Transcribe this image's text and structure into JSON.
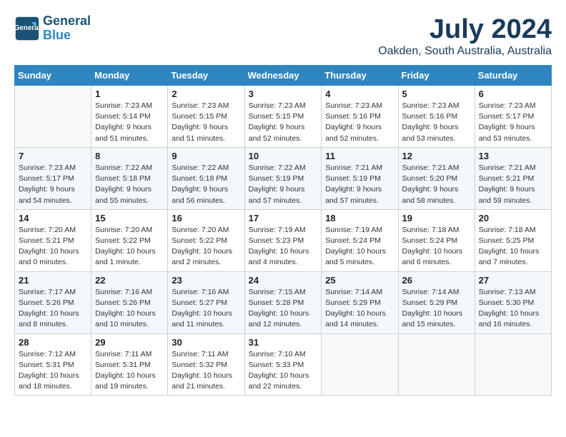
{
  "logo": {
    "line1": "General",
    "line2": "Blue"
  },
  "title": "July 2024",
  "location": "Oakden, South Australia, Australia",
  "days_of_week": [
    "Sunday",
    "Monday",
    "Tuesday",
    "Wednesday",
    "Thursday",
    "Friday",
    "Saturday"
  ],
  "weeks": [
    [
      {
        "day": "",
        "info": ""
      },
      {
        "day": "1",
        "info": "Sunrise: 7:23 AM\nSunset: 5:14 PM\nDaylight: 9 hours\nand 51 minutes."
      },
      {
        "day": "2",
        "info": "Sunrise: 7:23 AM\nSunset: 5:15 PM\nDaylight: 9 hours\nand 51 minutes."
      },
      {
        "day": "3",
        "info": "Sunrise: 7:23 AM\nSunset: 5:15 PM\nDaylight: 9 hours\nand 52 minutes."
      },
      {
        "day": "4",
        "info": "Sunrise: 7:23 AM\nSunset: 5:16 PM\nDaylight: 9 hours\nand 52 minutes."
      },
      {
        "day": "5",
        "info": "Sunrise: 7:23 AM\nSunset: 5:16 PM\nDaylight: 9 hours\nand 53 minutes."
      },
      {
        "day": "6",
        "info": "Sunrise: 7:23 AM\nSunset: 5:17 PM\nDaylight: 9 hours\nand 53 minutes."
      }
    ],
    [
      {
        "day": "7",
        "info": "Sunrise: 7:23 AM\nSunset: 5:17 PM\nDaylight: 9 hours\nand 54 minutes."
      },
      {
        "day": "8",
        "info": "Sunrise: 7:22 AM\nSunset: 5:18 PM\nDaylight: 9 hours\nand 55 minutes."
      },
      {
        "day": "9",
        "info": "Sunrise: 7:22 AM\nSunset: 5:18 PM\nDaylight: 9 hours\nand 56 minutes."
      },
      {
        "day": "10",
        "info": "Sunrise: 7:22 AM\nSunset: 5:19 PM\nDaylight: 9 hours\nand 57 minutes."
      },
      {
        "day": "11",
        "info": "Sunrise: 7:21 AM\nSunset: 5:19 PM\nDaylight: 9 hours\nand 57 minutes."
      },
      {
        "day": "12",
        "info": "Sunrise: 7:21 AM\nSunset: 5:20 PM\nDaylight: 9 hours\nand 58 minutes."
      },
      {
        "day": "13",
        "info": "Sunrise: 7:21 AM\nSunset: 5:21 PM\nDaylight: 9 hours\nand 59 minutes."
      }
    ],
    [
      {
        "day": "14",
        "info": "Sunrise: 7:20 AM\nSunset: 5:21 PM\nDaylight: 10 hours\nand 0 minutes."
      },
      {
        "day": "15",
        "info": "Sunrise: 7:20 AM\nSunset: 5:22 PM\nDaylight: 10 hours\nand 1 minute."
      },
      {
        "day": "16",
        "info": "Sunrise: 7:20 AM\nSunset: 5:22 PM\nDaylight: 10 hours\nand 2 minutes."
      },
      {
        "day": "17",
        "info": "Sunrise: 7:19 AM\nSunset: 5:23 PM\nDaylight: 10 hours\nand 4 minutes."
      },
      {
        "day": "18",
        "info": "Sunrise: 7:19 AM\nSunset: 5:24 PM\nDaylight: 10 hours\nand 5 minutes."
      },
      {
        "day": "19",
        "info": "Sunrise: 7:18 AM\nSunset: 5:24 PM\nDaylight: 10 hours\nand 6 minutes."
      },
      {
        "day": "20",
        "info": "Sunrise: 7:18 AM\nSunset: 5:25 PM\nDaylight: 10 hours\nand 7 minutes."
      }
    ],
    [
      {
        "day": "21",
        "info": "Sunrise: 7:17 AM\nSunset: 5:26 PM\nDaylight: 10 hours\nand 8 minutes."
      },
      {
        "day": "22",
        "info": "Sunrise: 7:16 AM\nSunset: 5:26 PM\nDaylight: 10 hours\nand 10 minutes."
      },
      {
        "day": "23",
        "info": "Sunrise: 7:16 AM\nSunset: 5:27 PM\nDaylight: 10 hours\nand 11 minutes."
      },
      {
        "day": "24",
        "info": "Sunrise: 7:15 AM\nSunset: 5:28 PM\nDaylight: 10 hours\nand 12 minutes."
      },
      {
        "day": "25",
        "info": "Sunrise: 7:14 AM\nSunset: 5:29 PM\nDaylight: 10 hours\nand 14 minutes."
      },
      {
        "day": "26",
        "info": "Sunrise: 7:14 AM\nSunset: 5:29 PM\nDaylight: 10 hours\nand 15 minutes."
      },
      {
        "day": "27",
        "info": "Sunrise: 7:13 AM\nSunset: 5:30 PM\nDaylight: 10 hours\nand 16 minutes."
      }
    ],
    [
      {
        "day": "28",
        "info": "Sunrise: 7:12 AM\nSunset: 5:31 PM\nDaylight: 10 hours\nand 18 minutes."
      },
      {
        "day": "29",
        "info": "Sunrise: 7:11 AM\nSunset: 5:31 PM\nDaylight: 10 hours\nand 19 minutes."
      },
      {
        "day": "30",
        "info": "Sunrise: 7:11 AM\nSunset: 5:32 PM\nDaylight: 10 hours\nand 21 minutes."
      },
      {
        "day": "31",
        "info": "Sunrise: 7:10 AM\nSunset: 5:33 PM\nDaylight: 10 hours\nand 22 minutes."
      },
      {
        "day": "",
        "info": ""
      },
      {
        "day": "",
        "info": ""
      },
      {
        "day": "",
        "info": ""
      }
    ]
  ]
}
